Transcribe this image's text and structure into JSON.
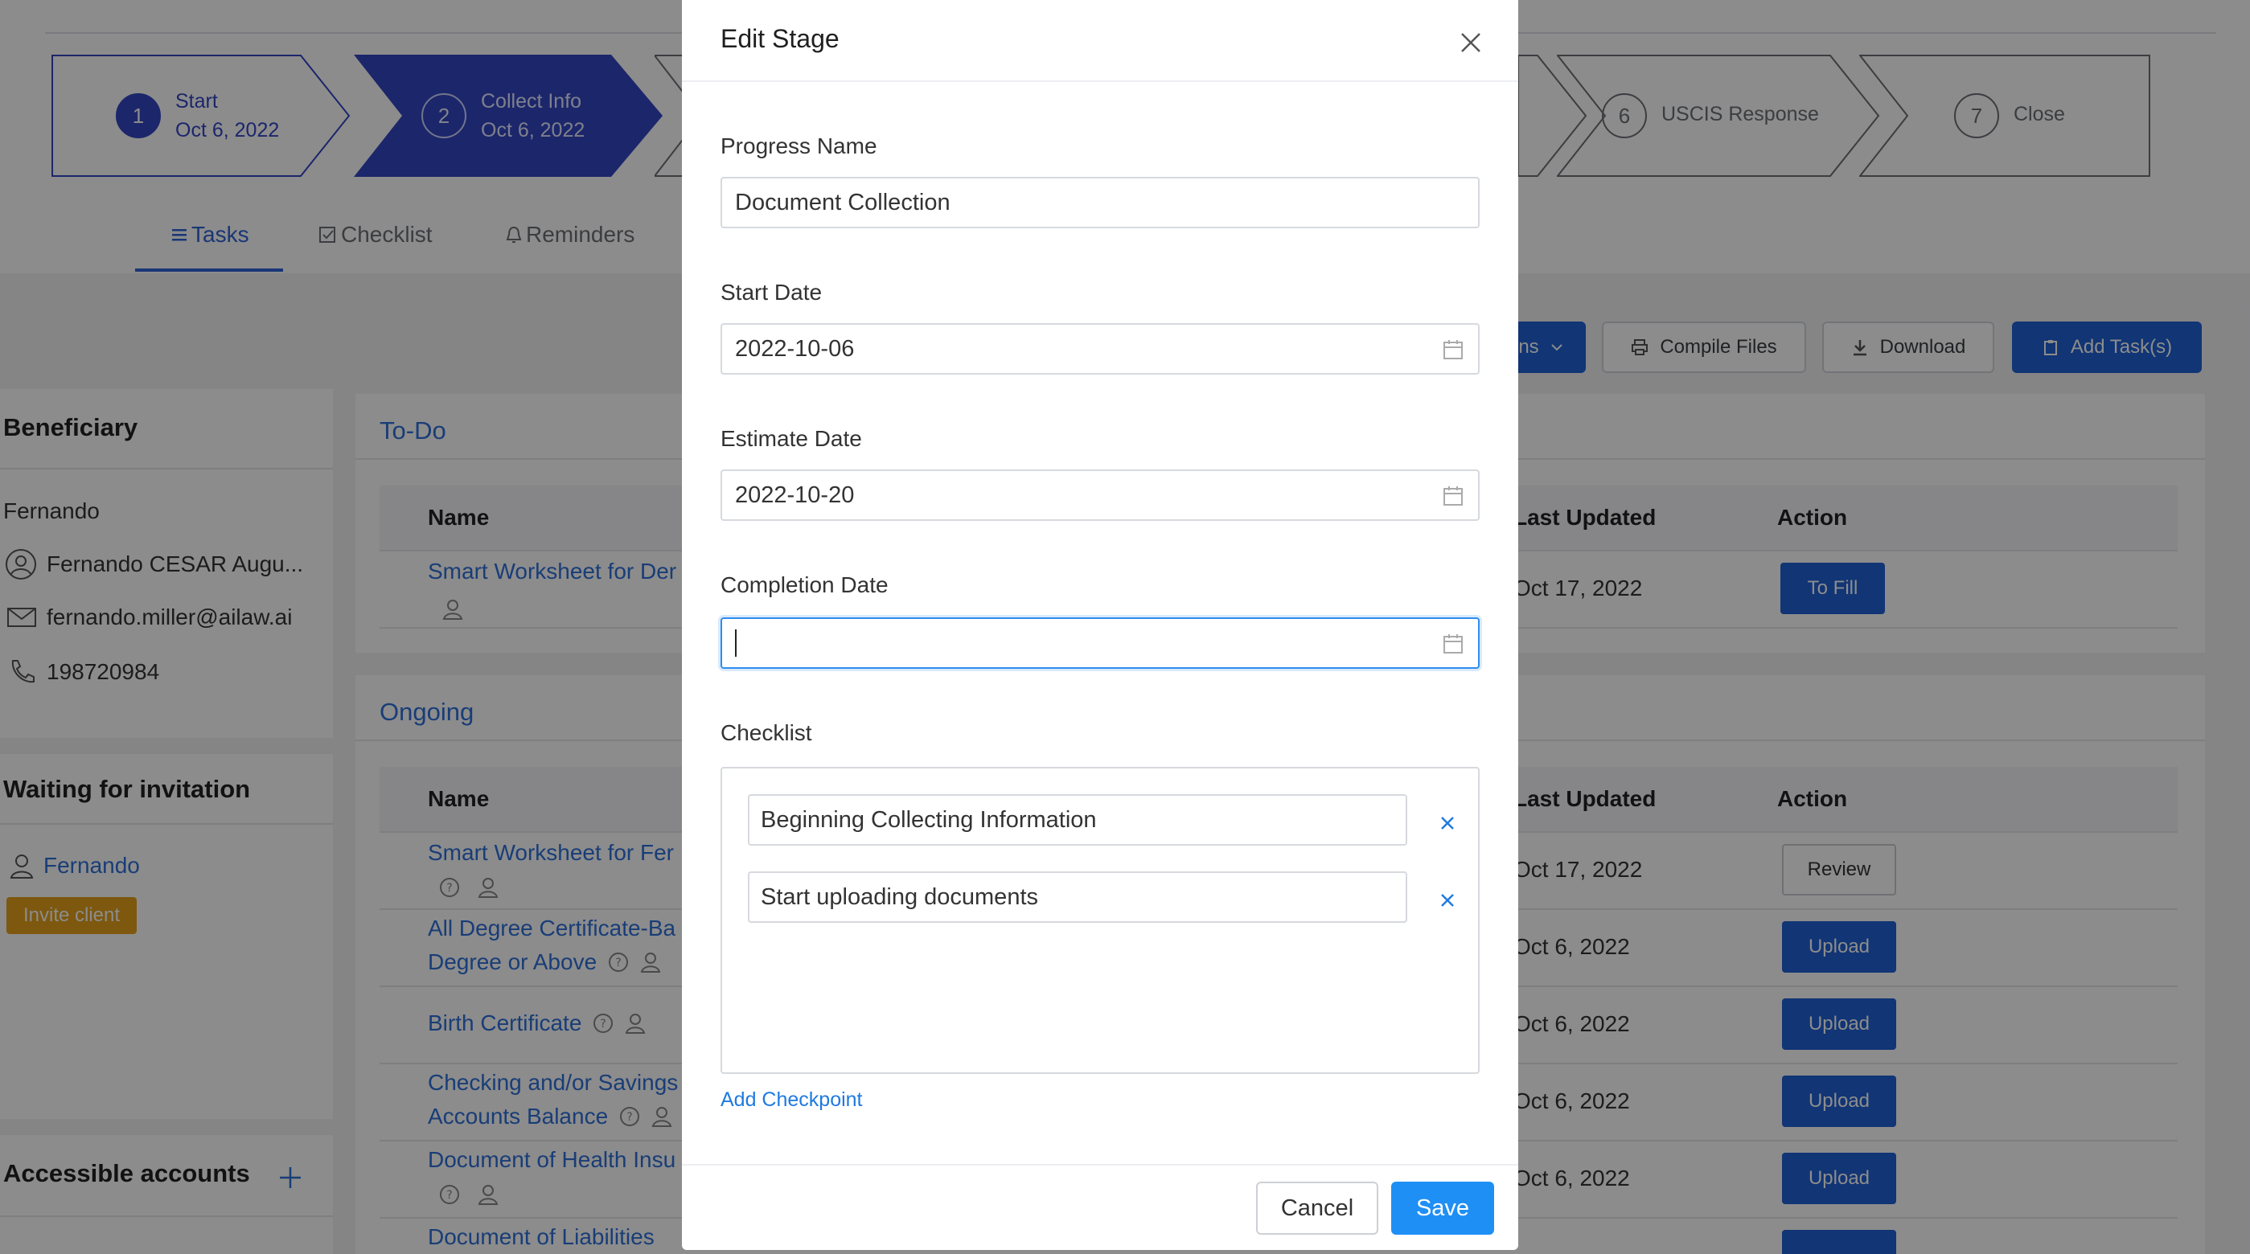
{
  "stages": [
    {
      "num": "1",
      "label": "Start",
      "date": "Oct 6, 2022"
    },
    {
      "num": "2",
      "label": "Collect Info",
      "date": "Oct 6, 2022"
    },
    {
      "num": "6",
      "label": "USCIS Response",
      "date": ""
    },
    {
      "num": "7",
      "label": "Close",
      "date": ""
    }
  ],
  "tabs": [
    "Tasks",
    "Checklist",
    "Reminders"
  ],
  "toolbar": {
    "actions_partial": "ns",
    "compile": "Compile Files",
    "download": "Download",
    "add_task": "Add Task(s)"
  },
  "sidebar": {
    "beneficiary_title": "Beneficiary",
    "name": "Fernando",
    "full_name": "Fernando CESAR Augu...",
    "email": "fernando.miller@ailaw.ai",
    "phone": "198720984",
    "waiting_title": "Waiting for invitation",
    "invitee": "Fernando",
    "invite_label": "Invite client",
    "accounts_title": "Accessible accounts"
  },
  "todo": {
    "title": "To-Do",
    "col_name": "Name",
    "col_updated": "Last Updated",
    "col_action": "Action",
    "rows": [
      {
        "name": "Smart Worksheet for Der",
        "updated": "Oct 17, 2022",
        "action": "To Fill"
      }
    ]
  },
  "ongoing": {
    "title": "Ongoing",
    "col_name": "Name",
    "col_updated": "Last Updated",
    "col_action": "Action",
    "rows": [
      {
        "line1": "Smart Worksheet for Fer",
        "line2": "",
        "updated": "Oct 17, 2022",
        "action": "Review"
      },
      {
        "line1": "All Degree Certificate-Ba",
        "line2": "Degree or Above",
        "updated": "Oct 6, 2022",
        "action": "Upload"
      },
      {
        "line1": "Birth Certificate",
        "line2": "",
        "updated": "Oct 6, 2022",
        "action": "Upload"
      },
      {
        "line1": "Checking and/or Savings",
        "line2": "Accounts Balance",
        "updated": "Oct 6, 2022",
        "action": "Upload"
      },
      {
        "line1": "Document of Health Insu",
        "line2": "",
        "updated": "Oct 6, 2022",
        "action": "Upload"
      },
      {
        "line1": "Document of Liabilities",
        "line2": "",
        "updated": "",
        "action": ""
      }
    ]
  },
  "modal": {
    "title": "Edit Stage",
    "progress_name_label": "Progress Name",
    "progress_name_value": "Document Collection",
    "start_date_label": "Start Date",
    "start_date_value": "2022-10-06",
    "estimate_date_label": "Estimate Date",
    "estimate_date_value": "2022-10-20",
    "completion_date_label": "Completion Date",
    "completion_date_value": "",
    "checklist_label": "Checklist",
    "checklist_items": [
      "Beginning Collecting Information",
      "Start uploading documents"
    ],
    "add_checkpoint": "Add Checkpoint",
    "cancel": "Cancel",
    "save": "Save"
  },
  "colors": {
    "accent": "#1e8ff5",
    "stage_active": "#3345c4",
    "link": "#2f6fd9",
    "invite": "#e3a01b"
  }
}
